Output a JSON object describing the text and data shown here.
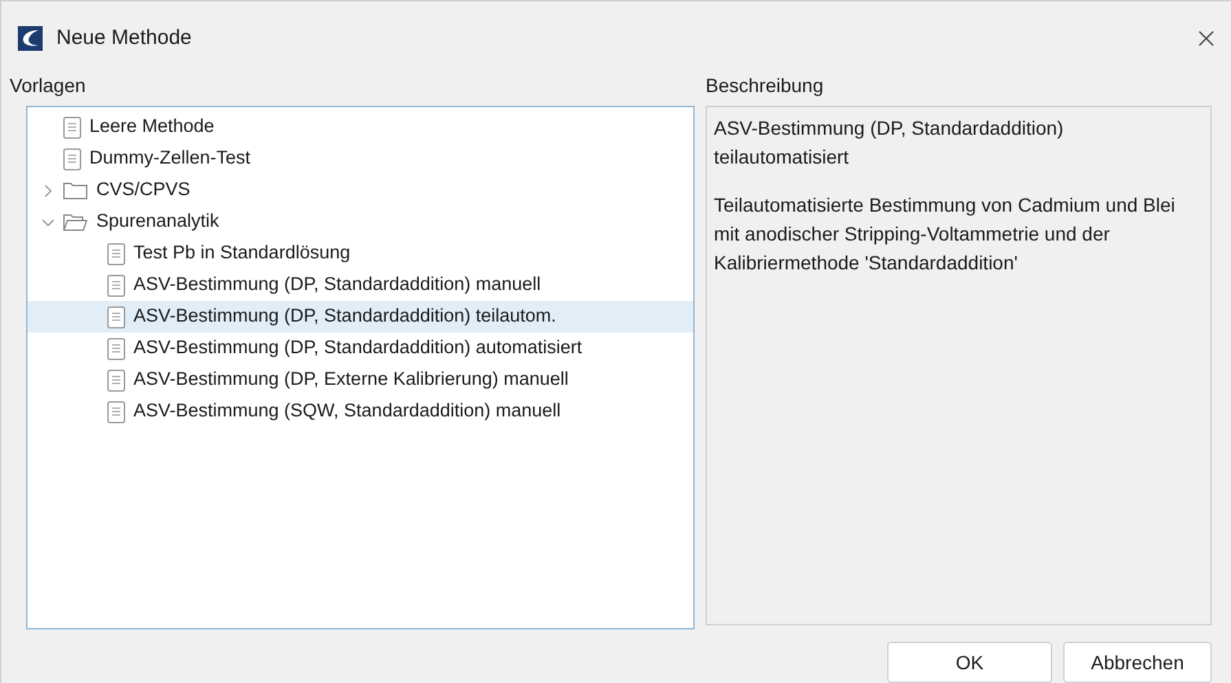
{
  "window": {
    "title": "Neue Methode"
  },
  "templates": {
    "label": "Vorlagen",
    "items": [
      {
        "kind": "file",
        "label": "Leere Methode",
        "selected": false
      },
      {
        "kind": "file",
        "label": "Dummy-Zellen-Test",
        "selected": false
      },
      {
        "kind": "folder",
        "label": "CVS/CPVS",
        "expanded": false,
        "selected": false
      },
      {
        "kind": "folder",
        "label": "Spurenanalytik",
        "expanded": true,
        "selected": false,
        "children": [
          {
            "kind": "file",
            "label": "Test Pb in Standardlösung",
            "selected": false
          },
          {
            "kind": "file",
            "label": "ASV-Bestimmung (DP, Standardaddition) manuell",
            "selected": false
          },
          {
            "kind": "file",
            "label": "ASV-Bestimmung (DP, Standardaddition) teilautom.",
            "selected": true
          },
          {
            "kind": "file",
            "label": "ASV-Bestimmung (DP, Standardaddition) automatisiert",
            "selected": false
          },
          {
            "kind": "file",
            "label": "ASV-Bestimmung (DP, Externe Kalibrierung) manuell",
            "selected": false
          },
          {
            "kind": "file",
            "label": "ASV-Bestimmung (SQW, Standardaddition) manuell",
            "selected": false
          }
        ]
      }
    ]
  },
  "description": {
    "label": "Beschreibung",
    "title": "ASV-Bestimmung (DP, Standardaddition) teilautomatisiert",
    "text": "Teilautomatisierte Bestimmung von Cadmium und Blei mit anodischer Stripping-Voltammetrie und der Kalibriermethode 'Standardaddition'"
  },
  "buttons": [
    "OK",
    "Abbrechen"
  ]
}
